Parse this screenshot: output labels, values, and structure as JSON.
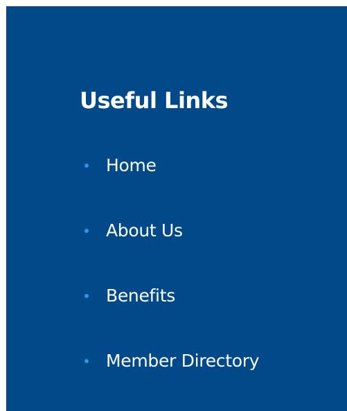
{
  "colors": {
    "panel_background": "#02498a",
    "text": "#ffffff",
    "bullet": "#2e94e6"
  },
  "useful_links": {
    "heading": "Useful Links",
    "items": [
      {
        "label": "Home",
        "icon": "bullet-dot-icon"
      },
      {
        "label": "About Us",
        "icon": "bullet-dot-icon"
      },
      {
        "label": "Benefits",
        "icon": "bullet-dot-icon"
      },
      {
        "label": "Member Directory",
        "icon": "bullet-dot-icon"
      }
    ]
  }
}
